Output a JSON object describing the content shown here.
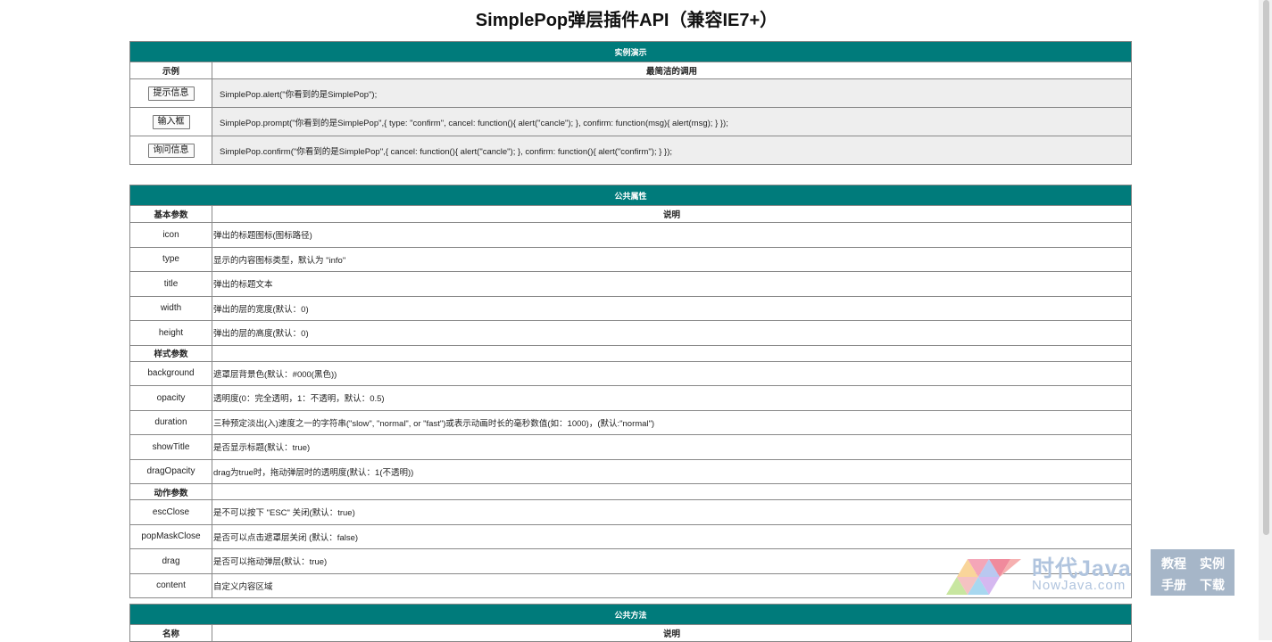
{
  "title": "SimplePop弹层插件API（兼容IE7+）",
  "demo": {
    "band": "实例演示",
    "col1": "示例",
    "col2": "最简洁的调用",
    "rows": [
      {
        "button": "提示信息",
        "code": "SimplePop.alert(\"你看到的是SimplePop\");"
      },
      {
        "button": "输入框",
        "code": "SimplePop.prompt(\"你看到的是SimplePop\",{ type: \"confirm\", cancel: function(){ alert(\"cancle\"); }, confirm: function(msg){ alert(msg); } });"
      },
      {
        "button": "询问信息",
        "code": "SimplePop.confirm(\"你看到的是SimplePop\",{ cancel: function(){ alert(\"cancle\"); }, confirm: function(){ alert(\"confirm\"); } });"
      }
    ]
  },
  "props": {
    "band": "公共属性",
    "col1": "基本参数",
    "col2": "说明",
    "basic": [
      {
        "name": "icon",
        "desc": "弹出的标题图标(图标路径)"
      },
      {
        "name": "type",
        "desc": "显示的内容图标类型，默认为 \"info\""
      },
      {
        "name": "title",
        "desc": "弹出的标题文本"
      },
      {
        "name": "width",
        "desc": "弹出的层的宽度(默认：0)"
      },
      {
        "name": "height",
        "desc": "弹出的层的高度(默认：0)"
      }
    ],
    "style_group": "样式参数",
    "style": [
      {
        "name": "background",
        "desc": "遮罩层背景色(默认：#000(黑色))"
      },
      {
        "name": "opacity",
        "desc": "透明度(0：完全透明，1：不透明，默认：0.5)"
      },
      {
        "name": "duration",
        "desc": "三种预定淡出(入)速度之一的字符串(\"slow\", \"normal\", or \"fast\")或表示动画时长的毫秒数值(如：1000)，(默认:\"normal\")"
      },
      {
        "name": "showTitle",
        "desc": "是否显示标题(默认：true)"
      },
      {
        "name": "dragOpacity",
        "desc": "drag为true时，拖动弹层时的透明度(默认：1(不透明))"
      }
    ],
    "action_group": "动作参数",
    "action": [
      {
        "name": "escClose",
        "desc": "是不可以按下 \"ESC\" 关闭(默认：true)"
      },
      {
        "name": "popMaskClose",
        "desc": "是否可以点击遮罩层关闭 (默认：false)"
      },
      {
        "name": "drag",
        "desc": "是否可以拖动弹层(默认：true)"
      },
      {
        "name": "content",
        "desc": "自定义内容区域"
      }
    ]
  },
  "methods": {
    "band": "公共方法",
    "col1": "名称",
    "col2": "说明"
  },
  "watermark": {
    "title": "时代Java",
    "domain": "NowJava.com",
    "box": [
      "教程",
      "实例",
      "手册",
      "下载"
    ]
  },
  "colors": {
    "band": "#007b7b",
    "row": "#eeeeee"
  }
}
